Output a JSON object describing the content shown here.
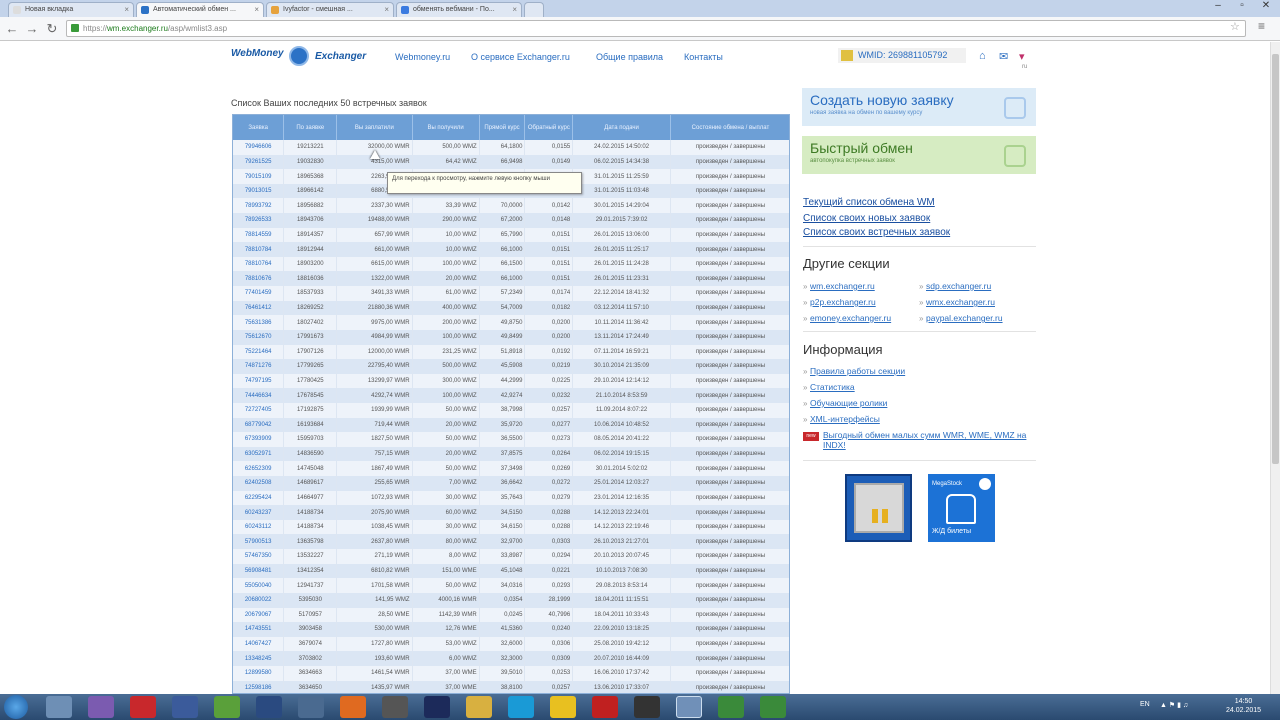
{
  "browser": {
    "tabs": [
      {
        "label": "Новая вкладка",
        "active": false
      },
      {
        "label": "Автоматический обмен ...",
        "active": true
      },
      {
        "label": "Ivyfactor - смешная ...",
        "active": false
      },
      {
        "label": "обменять вебмани - По...",
        "active": false
      }
    ],
    "url_scheme": "https://",
    "url_host": "wm.exchanger.ru",
    "url_path": "/asp/wmlist3.asp"
  },
  "site": {
    "logo_left": "WebMoney",
    "logo_right": "Exchanger",
    "nav": [
      "Webmoney.ru",
      "О сервисе Exchanger.ru",
      "Общие правила",
      "Контакты"
    ],
    "wmid": "WMID: 269881105792",
    "lang": "ru"
  },
  "table": {
    "caption": "Список Ваших последних 50 встречных заявок",
    "headers": [
      "Заявка",
      "По заявке",
      "Вы заплатили",
      "Вы получили",
      "Прямой курс",
      "Обратный курс",
      "Дата подачи",
      "Состояние обмена / выплат"
    ],
    "rows": [
      [
        "79946606",
        "19213221",
        "32000,00 WMR",
        "500,00 WMZ",
        "64,1800",
        "0,0155",
        "24.02.2015 14:50:02",
        "произведен / завершены"
      ],
      [
        "79261525",
        "19032830",
        "4315,00 WMR",
        "64,42 WMZ",
        "66,9498",
        "0,0149",
        "06.02.2015 14:34:38",
        "произведен / завершены"
      ],
      [
        "79015109",
        "18965368",
        "2263,90 WMR",
        "",
        "",
        "",
        "31.01.2015 11:25:59",
        "произведен / завершены"
      ],
      [
        "79013015",
        "18966142",
        "6880,50 WMR",
        "",
        "",
        "",
        "31.01.2015 11:03:48",
        "произведен / завершены"
      ],
      [
        "78993792",
        "18956882",
        "2337,30 WMR",
        "33,39 WMZ",
        "70,0000",
        "0,0142",
        "30.01.2015 14:29:04",
        "произведен / завершены"
      ],
      [
        "78926533",
        "18943706",
        "19488,00 WMR",
        "290,00 WMZ",
        "67,2000",
        "0,0148",
        "29.01.2015 7:39:02",
        "произведен / завершены"
      ],
      [
        "78814559",
        "18914357",
        "657,99 WMR",
        "10,00 WMZ",
        "65,7990",
        "0,0151",
        "26.01.2015 13:06:00",
        "произведен / завершены"
      ],
      [
        "78810784",
        "18912944",
        "661,00 WMR",
        "10,00 WMZ",
        "66,1000",
        "0,0151",
        "26.01.2015 11:25:17",
        "произведен / завершены"
      ],
      [
        "78810764",
        "18903200",
        "6615,00 WMR",
        "100,00 WMZ",
        "66,1500",
        "0,0151",
        "26.01.2015 11:24:28",
        "произведен / завершены"
      ],
      [
        "78810676",
        "18816036",
        "1322,00 WMR",
        "20,00 WMZ",
        "66,1000",
        "0,0151",
        "26.01.2015 11:23:31",
        "произведен / завершены"
      ],
      [
        "77401459",
        "18537933",
        "3491,33 WMR",
        "61,00 WMZ",
        "57,2349",
        "0,0174",
        "22.12.2014 18:41:32",
        "произведен / завершены"
      ],
      [
        "76461412",
        "18269252",
        "21880,36 WMR",
        "400,00 WMZ",
        "54,7009",
        "0,0182",
        "03.12.2014 11:57:10",
        "произведен / завершены"
      ],
      [
        "75631386",
        "18027402",
        "9975,00 WMR",
        "200,00 WMZ",
        "49,8750",
        "0,0200",
        "10.11.2014 11:36:42",
        "произведен / завершены"
      ],
      [
        "75612670",
        "17991673",
        "4984,99 WMR",
        "100,00 WMZ",
        "49,8499",
        "0,0200",
        "13.11.2014 17:24:49",
        "произведен / завершены"
      ],
      [
        "75221464",
        "17907126",
        "12000,00 WMR",
        "231,25 WMZ",
        "51,8918",
        "0,0192",
        "07.11.2014 16:59:21",
        "произведен / завершены"
      ],
      [
        "74871276",
        "17799265",
        "22795,40 WMR",
        "500,00 WMZ",
        "45,5908",
        "0,0219",
        "30.10.2014 21:35:09",
        "произведен / завершены"
      ],
      [
        "74797195",
        "17780425",
        "13299,97 WMR",
        "300,00 WMZ",
        "44,2999",
        "0,0225",
        "29.10.2014 12:14:12",
        "произведен / завершены"
      ],
      [
        "74446634",
        "17678545",
        "4292,74 WMR",
        "100,00 WMZ",
        "42,9274",
        "0,0232",
        "21.10.2014 8:53:59",
        "произведен / завершены"
      ],
      [
        "72727405",
        "17192875",
        "1939,99 WMR",
        "50,00 WMZ",
        "38,7998",
        "0,0257",
        "11.09.2014 8:07:22",
        "произведен / завершены"
      ],
      [
        "68779042",
        "16193684",
        "719,44 WMR",
        "20,00 WMZ",
        "35,9720",
        "0,0277",
        "10.06.2014 10:48:52",
        "произведен / завершены"
      ],
      [
        "67393909",
        "15959703",
        "1827,50 WMR",
        "50,00 WMZ",
        "36,5500",
        "0,0273",
        "08.05.2014 20:41:22",
        "произведен / завершены"
      ],
      [
        "63052971",
        "14836590",
        "757,15 WMR",
        "20,00 WMZ",
        "37,8575",
        "0,0264",
        "06.02.2014 19:15:15",
        "произведен / завершены"
      ],
      [
        "62652309",
        "14745048",
        "1867,49 WMR",
        "50,00 WMZ",
        "37,3498",
        "0,0269",
        "30.01.2014 5:02:02",
        "произведен / завершены"
      ],
      [
        "62402508",
        "14689617",
        "255,65 WMR",
        "7,00 WMZ",
        "36,6642",
        "0,0272",
        "25.01.2014 12:03:27",
        "произведен / завершены"
      ],
      [
        "62295424",
        "14664977",
        "1072,93 WMR",
        "30,00 WMZ",
        "35,7643",
        "0,0279",
        "23.01.2014 12:16:35",
        "произведен / завершены"
      ],
      [
        "60243237",
        "14188734",
        "2075,90 WMR",
        "60,00 WMZ",
        "34,5150",
        "0,0288",
        "14.12.2013 22:24:01",
        "произведен / завершены"
      ],
      [
        "60243112",
        "14188734",
        "1038,45 WMR",
        "30,00 WMZ",
        "34,6150",
        "0,0288",
        "14.12.2013 22:19:46",
        "произведен / завершены"
      ],
      [
        "57900513",
        "13635798",
        "2637,80 WMR",
        "80,00 WMZ",
        "32,9700",
        "0,0303",
        "26.10.2013 21:27:01",
        "произведен / завершены"
      ],
      [
        "57467350",
        "13532227",
        "271,19 WMR",
        "8,00 WMZ",
        "33,8987",
        "0,0294",
        "20.10.2013 20:07:45",
        "произведен / завершены"
      ],
      [
        "56908481",
        "13412354",
        "6810,82 WMR",
        "151,00 WME",
        "45,1048",
        "0,0221",
        "10.10.2013 7:08:30",
        "произведен / завершены"
      ],
      [
        "55050040",
        "12941737",
        "1701,58 WMR",
        "50,00 WMZ",
        "34,0316",
        "0,0293",
        "29.08.2013 8:53:14",
        "произведен / завершены"
      ],
      [
        "20680022",
        "5395030",
        "141,95 WMZ",
        "4000,16 WMR",
        "0,0354",
        "28,1999",
        "18.04.2011 11:15:51",
        "произведен / завершены"
      ],
      [
        "20679067",
        "5170957",
        "28,50 WME",
        "1142,39 WMR",
        "0,0245",
        "40,7996",
        "18.04.2011 10:33:43",
        "произведен / завершены"
      ],
      [
        "14743551",
        "3903458",
        "530,00 WMR",
        "12,76 WME",
        "41,5360",
        "0,0240",
        "22.09.2010 13:18:25",
        "произведен / завершены"
      ],
      [
        "14067427",
        "3679074",
        "1727,80 WMR",
        "53,00 WMZ",
        "32,6000",
        "0,0306",
        "25.08.2010 19:42:12",
        "произведен / завершены"
      ],
      [
        "13348245",
        "3703802",
        "193,60 WMR",
        "6,00 WMZ",
        "32,3000",
        "0,0309",
        "20.07.2010 16:44:09",
        "произведен / завершены"
      ],
      [
        "12899580",
        "3634663",
        "1461,54 WMR",
        "37,00 WME",
        "39,5010",
        "0,0253",
        "16.06.2010 17:37:42",
        "произведен / завершены"
      ],
      [
        "12598186",
        "3634650",
        "1435,97 WMR",
        "37,00 WME",
        "38,8100",
        "0,0257",
        "13.06.2010 17:33:07",
        "произведен / завершены"
      ]
    ]
  },
  "tooltip": "Для перехода к просмотру, нажмите левую кнопку мыши",
  "sidebar": {
    "create_title": "Создать новую заявку",
    "create_sub": "новая заявка на обмен по вашему курсу",
    "quick_title": "Быстрый обмен",
    "quick_sub": "автопокупка встречных заявок",
    "links": [
      "Текущий список обмена WM",
      "Список своих новых заявок",
      "Список своих встречных заявок"
    ],
    "other_heading": "Другие секции",
    "other_left": [
      "wm.exchanger.ru",
      "p2p.exchanger.ru",
      "emoney.exchanger.ru"
    ],
    "other_right": [
      "sdp.exchanger.ru",
      "wmx.exchanger.ru",
      "paypal.exchanger.ru"
    ],
    "info_heading": "Информация",
    "info_links": [
      "Правила работы секции",
      "Статистика",
      "Обучающие ролики",
      "XML-интерфейсы"
    ],
    "promo": "Выгодный обмен малых сумм WMR, WME, WMZ на INDX!",
    "promo_badge": "new",
    "banner2_top": "MegaStock",
    "banner2_bottom": "Ж/Д билеты"
  },
  "taskbar": {
    "lang": "EN",
    "time": "14:50",
    "date": "24.02.2015"
  },
  "colors": {
    "table_header": "#6d9fd6",
    "create_bg": "#dcebf7",
    "quick_bg": "#d6ecc2"
  }
}
